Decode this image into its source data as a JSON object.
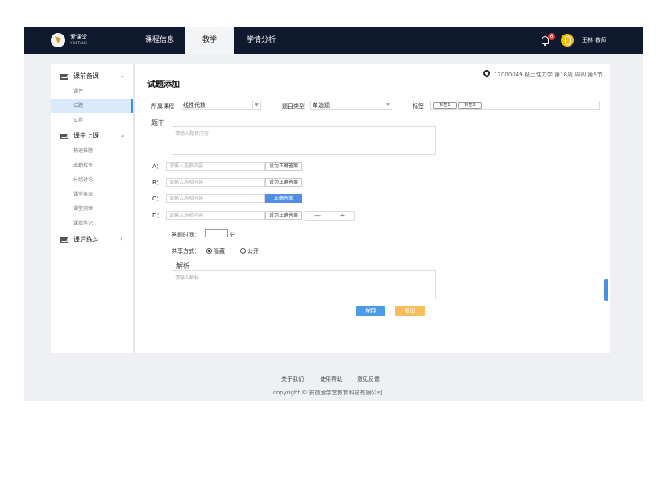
{
  "brand": {
    "name": "爱课堂",
    "subtitle": "YIKETANG"
  },
  "topnav": [
    {
      "label": "课程信息"
    },
    {
      "label": "教学"
    },
    {
      "label": "学情分析"
    }
  ],
  "user": {
    "notifications": "6",
    "name": "王林 教师"
  },
  "sidebar": {
    "groups": [
      {
        "label": "课前备课",
        "chevron": "⌄",
        "items": [
          "课件",
          "试题",
          "试卷"
        ]
      },
      {
        "label": "课中上课",
        "chevron": "⌄",
        "items": [
          "快速推题",
          "出勤检查",
          "分组讨论",
          "课堂表现",
          "课堂测验",
          "课后笔记"
        ]
      },
      {
        "label": "课后练习",
        "chevron": "›",
        "items": []
      }
    ],
    "active_item": "试题"
  },
  "main": {
    "title": "试题添加",
    "location": "17000049 粘土性力学 第18周 周四 第9节",
    "course_label": "所属课程",
    "course_value": "线性代数",
    "type_label": "题目类型",
    "type_value": "单选题",
    "tag_label": "标签",
    "tags": [
      "标签1",
      "标签2"
    ],
    "stem_label": "题干",
    "stem_placeholder": "请输入题目内容",
    "options": [
      {
        "label": "A：",
        "placeholder": "请输入选项内容",
        "button": "设为正确答案",
        "correct": false
      },
      {
        "label": "B：",
        "placeholder": "请输入选项内容",
        "button": "设为正确答案",
        "correct": false
      },
      {
        "label": "C：",
        "placeholder": "请输入选项内容",
        "button": "正确答案",
        "correct": true
      },
      {
        "label": "D：",
        "placeholder": "请输入选项内容",
        "button": "设为正确答案",
        "correct": false
      }
    ],
    "stepper": {
      "minus": "—",
      "plus": "+"
    },
    "time_label": "答题时间：",
    "time_unit": "分",
    "share_label": "共享方式：",
    "share_options": [
      {
        "label": "隐藏",
        "selected": true
      },
      {
        "label": "公开",
        "selected": false
      }
    ],
    "analysis_label": "解析",
    "analysis_placeholder": "请输入解析",
    "save_label": "保存",
    "exit_label": "退出"
  },
  "footer": {
    "links": [
      "关于我们",
      "使用帮助",
      "意见反馈"
    ],
    "copyright": "copyright © 安徽爱学堂教育科技有限公司"
  },
  "colors": {
    "topbar": "#0f1a2e",
    "accent": "#4a9be8",
    "warning": "#f8bd5c",
    "badge": "#e8332f"
  },
  "icons": {
    "location": "location-pin-icon",
    "bell": "bell-icon",
    "mail": "mail-icon"
  }
}
